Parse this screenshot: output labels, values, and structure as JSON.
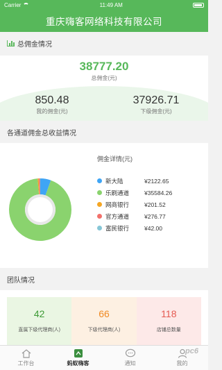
{
  "status_bar": {
    "carrier": "Carrier",
    "time": "11:49 AM"
  },
  "title": "重庆嗨客网络科技有限公司",
  "total_section": {
    "heading": "总佣金情况",
    "total": {
      "value": "38777.20",
      "label": "总佣金(元)"
    },
    "mine": {
      "value": "850.48",
      "label": "我的佣金(元)"
    },
    "downline": {
      "value": "37926.71",
      "label": "下级佣金(元)"
    }
  },
  "channel_section": {
    "heading": "各通道佣金总收益情况",
    "detail_title": "佣金详情(元)"
  },
  "chart_data": {
    "type": "pie",
    "title": "佣金详情(元)",
    "categories": [
      "新大陆",
      "乐刷通道",
      "网商银行",
      "官方通道",
      "富民银行"
    ],
    "values": [
      2122.65,
      35584.26,
      201.52,
      276.77,
      42.0
    ],
    "display_values": [
      "¥2122.65",
      "¥35584.26",
      "¥201.52",
      "¥276.77",
      "¥42.00"
    ],
    "colors": [
      "#3fa5f5",
      "#8ad36e",
      "#f5a623",
      "#f2706b",
      "#86c6d6"
    ],
    "legend": "right"
  },
  "team_section": {
    "heading": "团队情况",
    "cards": [
      {
        "value": "42",
        "label": "直属下级代理商(人)",
        "color": "#3d9a36",
        "bg": "#eaf6e3"
      },
      {
        "value": "66",
        "label": "下级代理商(人)",
        "color": "#f08a24",
        "bg": "#fdf0e2"
      },
      {
        "value": "118",
        "label": "店铺总数量",
        "color": "#e55a52",
        "bg": "#fde9e8"
      }
    ]
  },
  "tabbar": {
    "items": [
      {
        "label": "工作台",
        "icon": "home-icon"
      },
      {
        "label": "蚂蚁嗨客",
        "icon": "ant-hike-icon"
      },
      {
        "label": "通知",
        "icon": "chat-bubble-icon"
      },
      {
        "label": "我的",
        "icon": "user-icon"
      }
    ]
  },
  "watermark": "pc6"
}
